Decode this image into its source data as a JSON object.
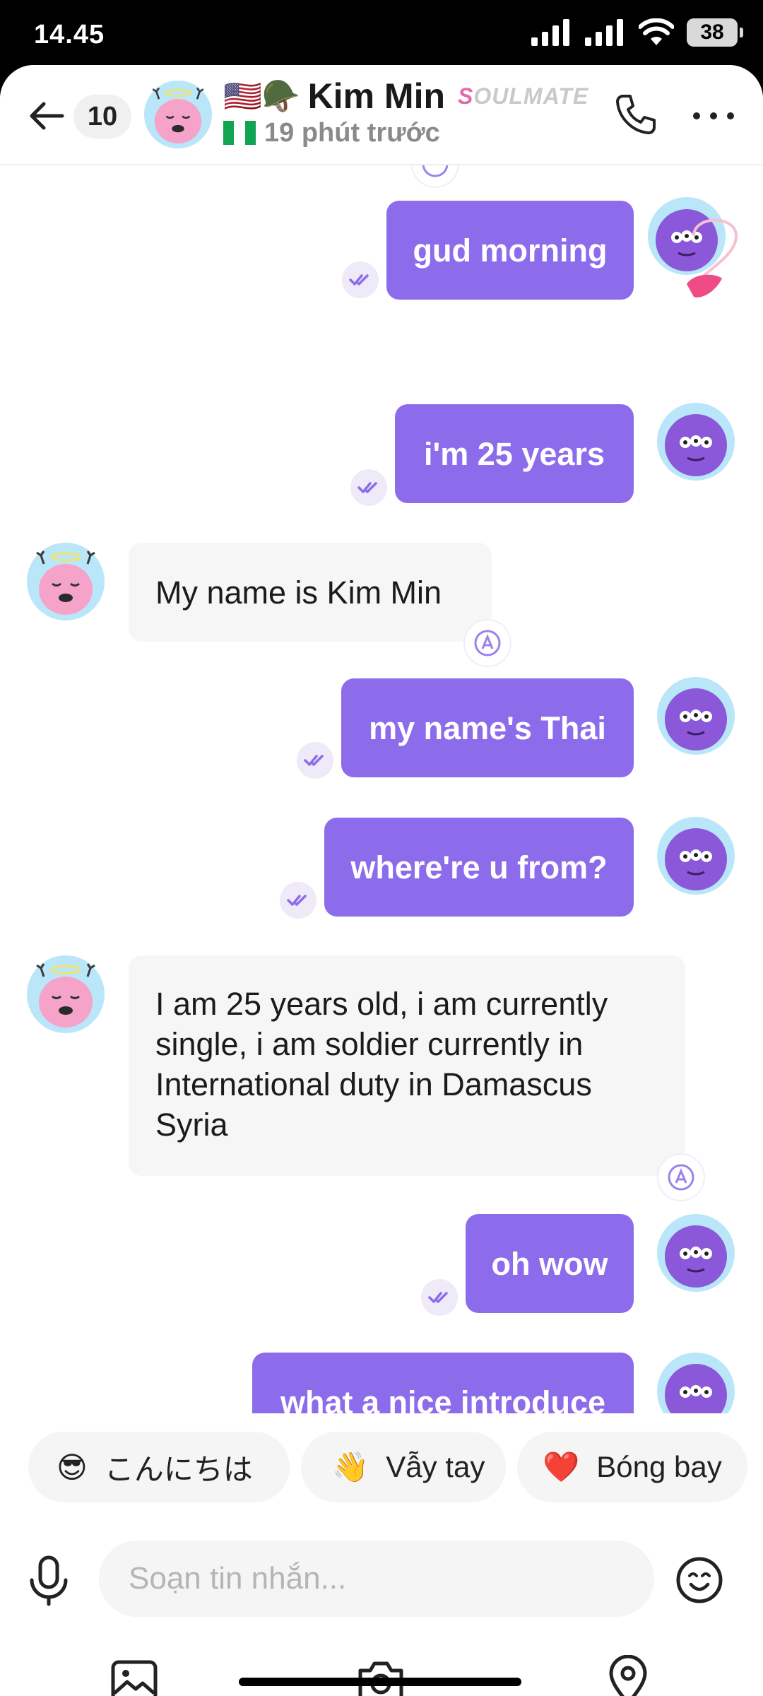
{
  "status_bar": {
    "time": "14.45",
    "battery": "38"
  },
  "header": {
    "unread_count": "10",
    "flags": "🇺🇸🪖",
    "name": "Kim Min",
    "badge_part1": "S",
    "badge_part2": "OULMATE",
    "last_seen": "19 phút trước",
    "country_flag_icon": "nigeria-flag-icon"
  },
  "messages": [
    {
      "side": "out",
      "text": "gud morning",
      "status": "read"
    },
    {
      "side": "out",
      "text": "i'm 25 years",
      "status": "read"
    },
    {
      "side": "in",
      "text": "My name is Kim Min"
    },
    {
      "side": "out",
      "text": "my name's Thai",
      "status": "read"
    },
    {
      "side": "out",
      "text": "where're u from?",
      "status": "read"
    },
    {
      "side": "in",
      "lines": [
        "I am 25 years old, i am currently",
        "single, i am soldier currently in",
        "International duty in Damascus",
        "Syria"
      ]
    },
    {
      "side": "out",
      "text": "oh wow",
      "status": "read"
    },
    {
      "side": "out",
      "text": "what a nice introduce",
      "status": "read"
    }
  ],
  "quick_replies": [
    {
      "emoji": "😎",
      "label": "こんにちは"
    },
    {
      "emoji": "👋",
      "label": "Vẫy tay"
    },
    {
      "emoji": "❤️",
      "label": "Bóng bay"
    }
  ],
  "composer": {
    "placeholder": "Soạn tin nhắn..."
  },
  "colors": {
    "outgoing_bubble": "#8d6cec",
    "incoming_bubble": "#f6f6f7",
    "accent": "#8d6cec"
  },
  "icons": [
    "back-arrow-icon",
    "phone-icon",
    "more-icon",
    "mic-icon",
    "emoji-icon",
    "gallery-icon",
    "camera-icon",
    "location-icon",
    "double-check-icon",
    "translate-icon"
  ]
}
